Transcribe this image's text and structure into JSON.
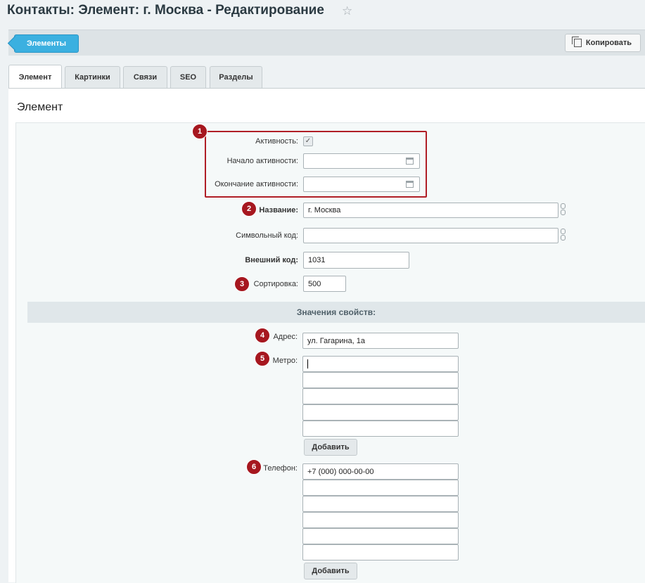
{
  "page": {
    "title": "Контакты: Элемент: г. Москва - Редактирование",
    "star_icon": "star-icon"
  },
  "toolbar": {
    "back_label": "Элементы",
    "copy_label": "Копировать"
  },
  "tabs": [
    {
      "label": "Элемент",
      "active": true
    },
    {
      "label": "Картинки",
      "active": false
    },
    {
      "label": "Связи",
      "active": false
    },
    {
      "label": "SEO",
      "active": false
    },
    {
      "label": "Разделы",
      "active": false
    }
  ],
  "section": {
    "title": "Элемент"
  },
  "fields": {
    "active": {
      "label": "Активность:",
      "checked": true
    },
    "active_from": {
      "label": "Начало активности:",
      "value": ""
    },
    "active_to": {
      "label": "Окончание активности:",
      "value": ""
    },
    "name": {
      "label": "Название:",
      "value": "г. Москва"
    },
    "code": {
      "label": "Символьный код:",
      "value": ""
    },
    "xml_id": {
      "label": "Внешний код:",
      "value": "1031"
    },
    "sort": {
      "label": "Сортировка:",
      "value": "500"
    }
  },
  "properties": {
    "header": "Значения свойств:",
    "address": {
      "label": "Адрес:",
      "value": "ул. Гагарина, 1а"
    },
    "metro": {
      "label": "Метро:",
      "values": [
        "",
        "",
        "",
        "",
        ""
      ],
      "add_label": "Добавить"
    },
    "phone": {
      "label": "Телефон:",
      "values": [
        "+7 (000) 000-00-00",
        "",
        "",
        "",
        "",
        ""
      ],
      "add_label": "Добавить"
    }
  },
  "badges": [
    "1",
    "2",
    "3",
    "4",
    "5",
    "6"
  ],
  "colors": {
    "accent": "#3bb0e0",
    "badge": "#a6171f"
  }
}
